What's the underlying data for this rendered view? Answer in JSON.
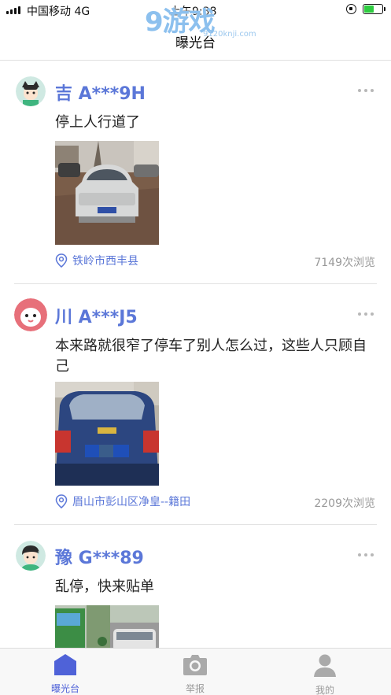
{
  "status_bar": {
    "carrier": "中国移动  4G",
    "time": "上午9:38"
  },
  "watermark": {
    "big": "9游戏",
    "small": "9120knji.com"
  },
  "header": {
    "title": "曝光台"
  },
  "posts": [
    {
      "username": "吉 A***9H",
      "content": "停上人行道了",
      "location": "铁岭市西丰县",
      "views": "7149次浏览"
    },
    {
      "username": "川 A***J5",
      "content": "本来路就很窄了停车了别人怎么过，这些人只顾自己",
      "location": "眉山市彭山区净皇--籍田",
      "views": "2209次浏览"
    },
    {
      "username": "豫 G***89",
      "content": "乱停，快来贴单"
    }
  ],
  "tabs": [
    {
      "label": "曝光台",
      "icon": "home-icon",
      "active": true
    },
    {
      "label": "举报",
      "icon": "camera-icon",
      "active": false
    },
    {
      "label": "我的",
      "icon": "user-icon",
      "active": false
    }
  ],
  "colors": {
    "accent": "#5b77d8",
    "tab_active": "#4f62d8",
    "muted": "#999999"
  }
}
